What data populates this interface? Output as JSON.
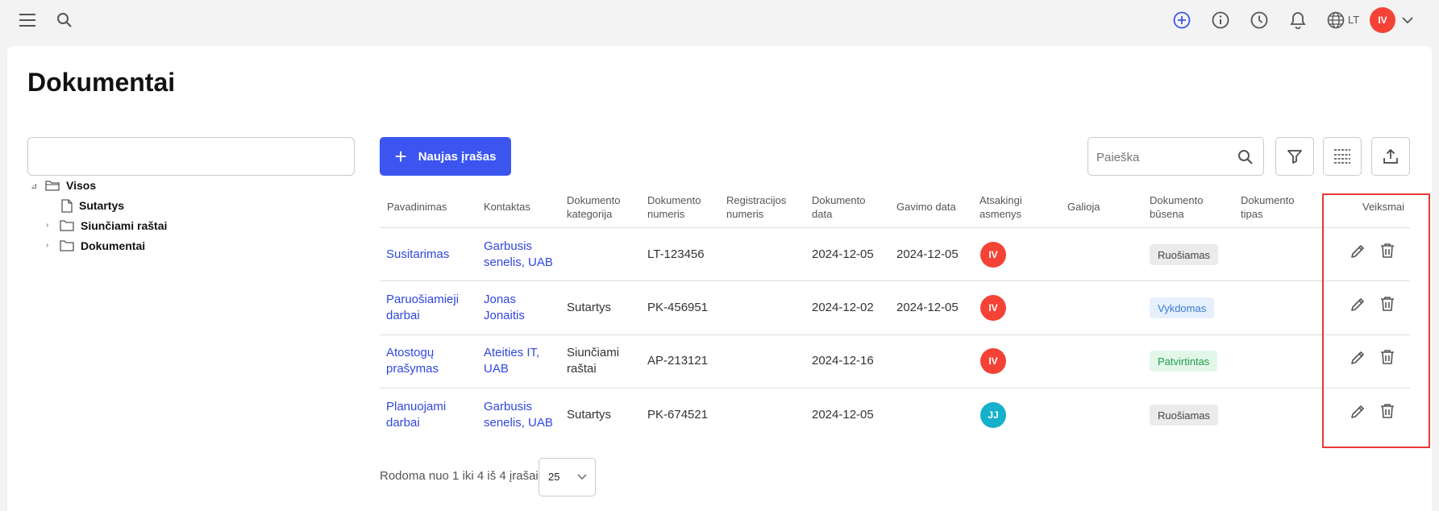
{
  "topbar": {
    "language": "LT",
    "user_initials": "IV",
    "colors": {
      "add": "#3c55f0",
      "avatar": "#f44336"
    }
  },
  "page": {
    "title": "Dokumentai"
  },
  "tree": {
    "search_value": "",
    "items": [
      {
        "label": "Visos",
        "icon": "folder-open-icon"
      },
      {
        "label": "Sutartys",
        "icon": "file-icon"
      },
      {
        "label": "Siunčiami raštai",
        "icon": "folder-icon"
      },
      {
        "label": "Dokumentai",
        "icon": "folder-icon"
      }
    ]
  },
  "toolbar": {
    "new_button_label": "Naujas įrašas",
    "search_placeholder": "Paieška"
  },
  "table": {
    "headers": [
      {
        "l1": "Pavadinimas",
        "l2": ""
      },
      {
        "l1": "Kontaktas",
        "l2": ""
      },
      {
        "l1": "Dokumento",
        "l2": "kategorija"
      },
      {
        "l1": "Dokumento",
        "l2": "numeris"
      },
      {
        "l1": "Registracijos",
        "l2": "numeris"
      },
      {
        "l1": "Dokumento",
        "l2": "data"
      },
      {
        "l1": "Gavimo data",
        "l2": ""
      },
      {
        "l1": "Atsakingi",
        "l2": "asmenys"
      },
      {
        "l1": "Galioja",
        "l2": ""
      },
      {
        "l1": "Dokumento",
        "l2": "būsena"
      },
      {
        "l1": "Dokumento",
        "l2": "tipas"
      },
      {
        "l1": "Veiksmai",
        "l2": ""
      }
    ],
    "rows": [
      {
        "name1": "Susitarimas",
        "name2": "",
        "contact1": "Garbusis",
        "contact2": "senelis, UAB",
        "cat1": "",
        "cat2": "",
        "number": "LT-123456",
        "reg": "",
        "doc_date": "2024-12-05",
        "recv_date": "2024-12-05",
        "resp": "IV",
        "resp_color": "#f44336",
        "valid": "",
        "status": "Ruošiamas",
        "status_bg": "#ebebeb",
        "status_fg": "#444444",
        "type": ""
      },
      {
        "name1": "Paruošiamieji",
        "name2": "darbai",
        "contact1": "Jonas",
        "contact2": "Jonaitis",
        "cat1": "Sutartys",
        "cat2": "",
        "number": "PK-456951",
        "reg": "",
        "doc_date": "2024-12-02",
        "recv_date": "2024-12-05",
        "resp": "IV",
        "resp_color": "#f44336",
        "valid": "",
        "status": "Vykdomas",
        "status_bg": "#e6f0fd",
        "status_fg": "#3a7bd5",
        "type": ""
      },
      {
        "name1": "Atostogų",
        "name2": "prašymas",
        "contact1": "Ateities IT,",
        "contact2": "UAB",
        "cat1": "Siunčiami",
        "cat2": "raštai",
        "number": "AP-213121",
        "reg": "",
        "doc_date": "2024-12-16",
        "recv_date": "",
        "resp": "IV",
        "resp_color": "#f44336",
        "valid": "",
        "status": "Patvirtintas",
        "status_bg": "#e3f7e9",
        "status_fg": "#1e9e4a",
        "type": ""
      },
      {
        "name1": "Planuojami",
        "name2": "darbai",
        "contact1": "Garbusis",
        "contact2": "senelis, UAB",
        "cat1": "Sutartys",
        "cat2": "",
        "number": "PK-674521",
        "reg": "",
        "doc_date": "2024-12-05",
        "recv_date": "",
        "resp": "JJ",
        "resp_color": "#15b0c9",
        "valid": "",
        "status": "Ruošiamas",
        "status_bg": "#ebebeb",
        "status_fg": "#444444",
        "type": ""
      }
    ]
  },
  "footer": {
    "showing": "Rodoma nuo 1 iki 4 iš 4 įrašai",
    "per_page": "25"
  }
}
